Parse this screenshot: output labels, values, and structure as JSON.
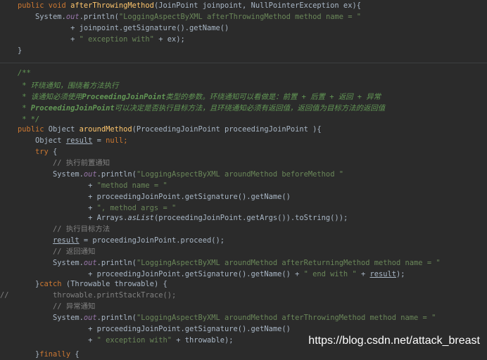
{
  "lines": [
    [
      [
        "kw",
        "public void "
      ],
      [
        "fn",
        "afterThrowingMethod"
      ],
      [
        "p",
        "(JoinPoint joinpoint, NullPointerException ex){"
      ]
    ],
    [
      [
        "p",
        "    System."
      ],
      [
        "it",
        "out"
      ],
      [
        "p",
        ".println("
      ],
      [
        "str",
        "\"LoggingAspectByXML afterThrowingMethod method name = \""
      ]
    ],
    [
      [
        "p",
        "            + joinpoint.getSignature().getName()"
      ]
    ],
    [
      [
        "p",
        "            + "
      ],
      [
        "str",
        "\" exception with\""
      ],
      [
        "p",
        " + ex);"
      ]
    ],
    [
      [
        "p",
        "}"
      ]
    ],
    [
      [
        "p",
        ""
      ]
    ],
    [
      [
        "doc",
        "/**"
      ]
    ],
    [
      [
        "doc",
        " * 环绕通知，围绕着方法执行"
      ]
    ],
    [
      [
        "doc",
        " * 该通知必须使用"
      ],
      [
        "docb",
        "ProceedingJoinPoint"
      ],
      [
        "doc",
        "类型的参数。环绕通知可以看做是：前置 + 后置 + 返回 + 异常"
      ]
    ],
    [
      [
        "doc",
        " * "
      ],
      [
        "docb",
        "ProceedingJoinPoint"
      ],
      [
        "doc",
        "可以决定是否执行目标方法，且环绕通知必须有返回值，返回值为目标方法的返回值"
      ]
    ],
    [
      [
        "doc",
        " * */"
      ]
    ],
    [
      [
        "kw",
        "public "
      ],
      [
        "p",
        "Object "
      ],
      [
        "fn",
        "aroundMethod"
      ],
      [
        "p",
        "(ProceedingJoinPoint proceedingJoinPoint ){"
      ]
    ],
    [
      [
        "p",
        "    Object "
      ],
      [
        "u",
        "result"
      ],
      [
        "p",
        " = "
      ],
      [
        "kw",
        "null"
      ],
      [
        "kw",
        ";"
      ]
    ],
    [
      [
        "kw",
        "    try "
      ],
      [
        "p",
        "{"
      ]
    ],
    [
      [
        "cmt",
        "        // 执行前置通知"
      ]
    ],
    [
      [
        "p",
        "        System."
      ],
      [
        "it",
        "out"
      ],
      [
        "p",
        ".println("
      ],
      [
        "str",
        "\"LoggingAspectByXML aroundMethod beforeMethod \""
      ]
    ],
    [
      [
        "p",
        "                + "
      ],
      [
        "str",
        "\"method name = \""
      ]
    ],
    [
      [
        "p",
        "                + proceedingJoinPoint.getSignature().getName()"
      ]
    ],
    [
      [
        "p",
        "                + "
      ],
      [
        "str",
        "\", method args = \""
      ]
    ],
    [
      [
        "p",
        "                + Arrays."
      ],
      [
        "meth-it",
        "asList"
      ],
      [
        "p",
        "(proceedingJoinPoint.getArgs()).toString());"
      ]
    ],
    [
      [
        "cmt",
        "        // 执行目标方法"
      ]
    ],
    [
      [
        "p",
        "        "
      ],
      [
        "u",
        "result"
      ],
      [
        "p",
        " = proceedingJoinPoint.proceed();"
      ]
    ],
    [
      [
        "cmt",
        "        // 返回通知"
      ]
    ],
    [
      [
        "p",
        "        System."
      ],
      [
        "it",
        "out"
      ],
      [
        "p",
        ".println("
      ],
      [
        "str",
        "\"LoggingAspectByXML aroundMethod afterReturningMethod method name = \""
      ]
    ],
    [
      [
        "p",
        "                + proceedingJoinPoint.getSignature().getName() + "
      ],
      [
        "str",
        "\" end with \""
      ],
      [
        "p",
        " + "
      ],
      [
        "u",
        "result"
      ],
      [
        "p",
        ");"
      ]
    ],
    [
      [
        "p",
        "    }"
      ],
      [
        "kw",
        "catch "
      ],
      [
        "p",
        "(Throwable throwable) {"
      ]
    ],
    [
      [
        "cmt",
        "//"
      ],
      [
        "cmt",
        "          throwable.printStackTrace();"
      ]
    ],
    [
      [
        "cmt",
        "        // 异常通知"
      ]
    ],
    [
      [
        "p",
        "        System."
      ],
      [
        "it",
        "out"
      ],
      [
        "p",
        ".println("
      ],
      [
        "str",
        "\"LoggingAspectByXML aroundMethod afterThrowingMethod method name = \""
      ]
    ],
    [
      [
        "p",
        "                + proceedingJoinPoint.getSignature().getName()"
      ]
    ],
    [
      [
        "p",
        "                + "
      ],
      [
        "str",
        "\" exception with\""
      ],
      [
        "p",
        " + throwable);"
      ]
    ],
    [
      [
        "p",
        "    }"
      ],
      [
        "kw",
        "finally "
      ],
      [
        "p",
        "{"
      ]
    ]
  ],
  "watermark": "https://blog.csdn.net/attack_breast"
}
